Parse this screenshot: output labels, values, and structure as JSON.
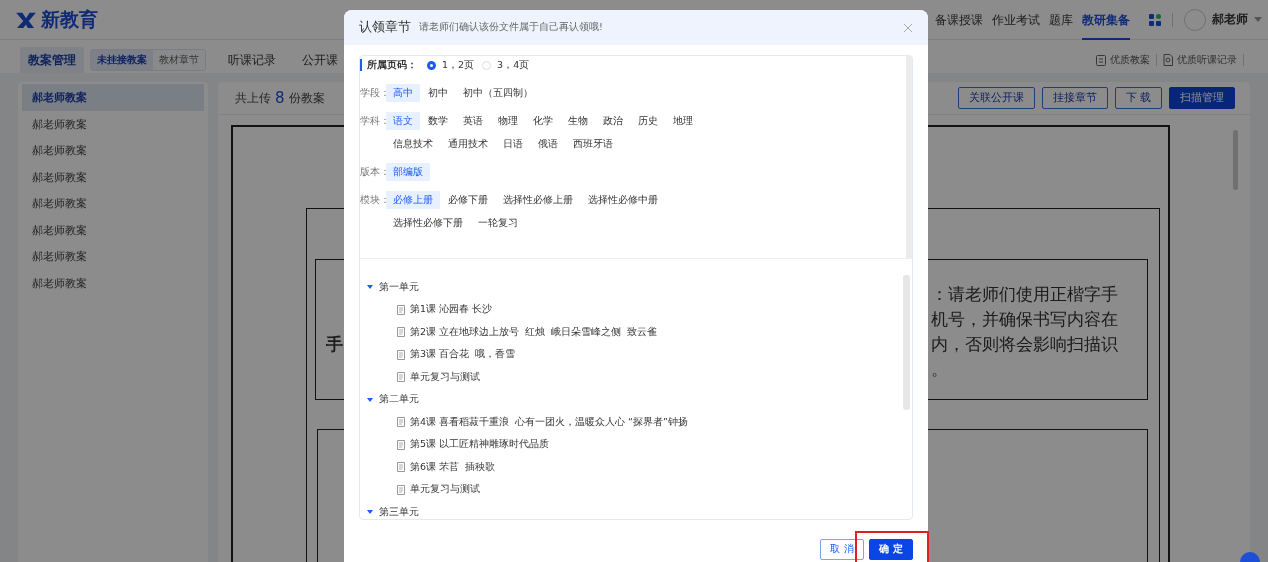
{
  "header": {
    "logo": "新教育",
    "nav": [
      {
        "label": "备课授课",
        "selected": false
      },
      {
        "label": "作业考试",
        "selected": false
      },
      {
        "label": "题库",
        "selected": false
      },
      {
        "label": "教研集备",
        "selected": true
      }
    ],
    "user": "郝老师"
  },
  "subnav": {
    "tabs": [
      {
        "label": "教案管理",
        "selected": true
      },
      {
        "label": "听课记录",
        "selected": false
      },
      {
        "label": "公开课",
        "selected": false
      }
    ],
    "segments": [
      {
        "label": "未挂接教案",
        "selected": true
      },
      {
        "label": "教材章节",
        "selected": false
      }
    ],
    "links": [
      "优质教案",
      "优质听课记录"
    ]
  },
  "sidebar": {
    "items": [
      {
        "label": "郝老师教案",
        "selected": true
      },
      {
        "label": "郝老师教案",
        "selected": false
      },
      {
        "label": "郝老师教案",
        "selected": false
      },
      {
        "label": "郝老师教案",
        "selected": false
      },
      {
        "label": "郝老师教案",
        "selected": false
      },
      {
        "label": "郝老师教案",
        "selected": false
      },
      {
        "label": "郝老师教案",
        "selected": false
      },
      {
        "label": "郝老师教案",
        "selected": false
      }
    ]
  },
  "main": {
    "summary": {
      "prefix": "共上传",
      "count": "8",
      "suffix": "份教案"
    },
    "buttons": [
      {
        "label": "关联公开课",
        "kind": "outline"
      },
      {
        "label": "挂接章节",
        "kind": "outline"
      },
      {
        "label": "下 载",
        "kind": "outline"
      },
      {
        "label": "扫描管理",
        "kind": "primary"
      }
    ],
    "document": {
      "left_text": "手",
      "lines": [
        "：请老师们使用正楷字手",
        "机号，并确保书写内容在",
        "内，否则将会影响扫描识",
        "。"
      ]
    }
  },
  "dialog": {
    "title": "认领章节",
    "subtitle": "请老师们确认该份文件属于自己再认领哦!",
    "pages": {
      "label": "所属页码：",
      "options": [
        {
          "label": "1，2页",
          "selected": true
        },
        {
          "label": "3，4页",
          "selected": false
        }
      ]
    },
    "filters": [
      {
        "label": "学段：",
        "options": [
          {
            "label": "高中",
            "selected": true
          },
          {
            "label": "初中",
            "selected": false
          },
          {
            "label": "初中（五四制）",
            "selected": false
          }
        ]
      },
      {
        "label": "学科：",
        "options": [
          {
            "label": "语文",
            "selected": true
          },
          {
            "label": "数学",
            "selected": false
          },
          {
            "label": "英语",
            "selected": false
          },
          {
            "label": "物理",
            "selected": false
          },
          {
            "label": "化学",
            "selected": false
          },
          {
            "label": "生物",
            "selected": false
          },
          {
            "label": "政治",
            "selected": false
          },
          {
            "label": "历史",
            "selected": false
          },
          {
            "label": "地理",
            "selected": false
          },
          {
            "label": "信息技术",
            "selected": false
          },
          {
            "label": "通用技术",
            "selected": false
          },
          {
            "label": "日语",
            "selected": false
          },
          {
            "label": "俄语",
            "selected": false
          },
          {
            "label": "西班牙语",
            "selected": false
          }
        ]
      },
      {
        "label": "版本：",
        "options": [
          {
            "label": "部编版",
            "selected": true
          }
        ]
      },
      {
        "label": "模块：",
        "options": [
          {
            "label": "必修上册",
            "selected": true
          },
          {
            "label": "必修下册",
            "selected": false
          },
          {
            "label": "选择性必修上册",
            "selected": false
          },
          {
            "label": "选择性必修中册",
            "selected": false
          },
          {
            "label": "选择性必修下册",
            "selected": false
          },
          {
            "label": "一轮复习",
            "selected": false
          }
        ]
      }
    ],
    "tree": [
      {
        "label": "第一单元",
        "expanded": true,
        "children": [
          {
            "label": "第1课 沁园春 长沙"
          },
          {
            "label": "第2课 立在地球边上放号  红烛  峨日朵雪峰之侧  致云雀"
          },
          {
            "label": "第3课 百合花  哦，香雪"
          },
          {
            "label": "单元复习与测试"
          }
        ]
      },
      {
        "label": "第二单元",
        "expanded": true,
        "children": [
          {
            "label": "第4课 喜看稻菽千重浪  心有一团火，温暖众人心 “探界者”钟扬"
          },
          {
            "label": "第5课 以工匠精神雕琢时代品质"
          },
          {
            "label": "第6课 芣苢  插秧歌"
          },
          {
            "label": "单元复习与测试"
          }
        ]
      },
      {
        "label": "第三单元",
        "expanded": true
      }
    ],
    "buttons": [
      {
        "label": "取 消",
        "kind": "cancel",
        "highlighted": false
      },
      {
        "label": "确 定",
        "kind": "primary",
        "highlighted": true
      }
    ]
  }
}
